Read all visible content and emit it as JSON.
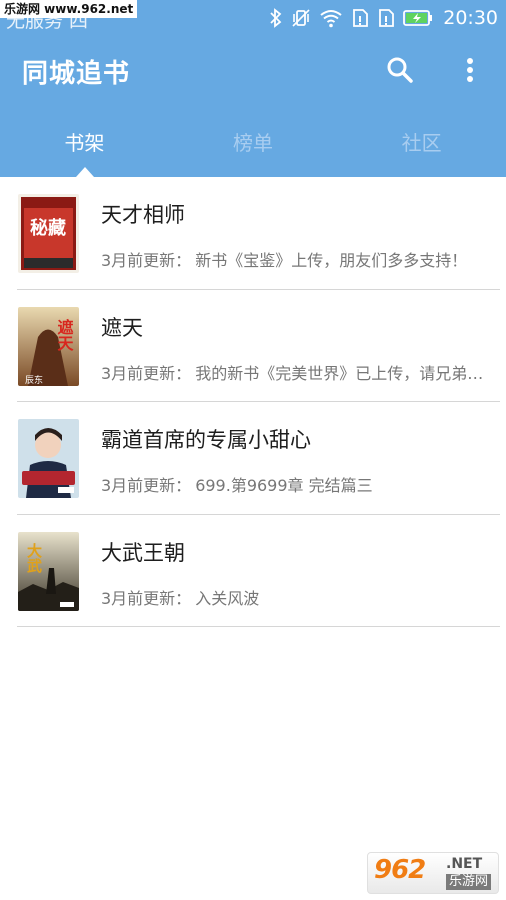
{
  "status_bar": {
    "carrier": "无服务 四",
    "time": "20:30",
    "watermark": "乐游网 www.962.net"
  },
  "toolbar": {
    "title": "同城追书",
    "icons": [
      "search-icon",
      "more-vert-icon"
    ]
  },
  "tabs": [
    {
      "label": "书架",
      "active": true
    },
    {
      "label": "榜单",
      "active": false
    },
    {
      "label": "社区",
      "active": false
    }
  ],
  "books": [
    {
      "title": "天才相师",
      "update_prefix": "3月前更新：",
      "latest": "新书《宝鉴》上传，朋友们多多支持！",
      "cover_text": "秘藏"
    },
    {
      "title": "遮天",
      "update_prefix": "3月前更新：",
      "latest": "我的新书《完美世界》已上传，请兄弟们支持",
      "cover_text": "遮天",
      "cover_author": "辰东"
    },
    {
      "title": "霸道首席的专属小甜心",
      "update_prefix": "3月前更新：",
      "latest": "699.第9699章 完结篇三"
    },
    {
      "title": "大武王朝",
      "update_prefix": "3月前更新：",
      "latest": "入关风波",
      "cover_text": "大武"
    }
  ],
  "watermark_bottom": {
    "logo": "962",
    "domain": ".NET",
    "name": "乐游网"
  },
  "colors": {
    "app_bar": "#66a9e2",
    "tab_inactive": "#a8cdf0",
    "text_primary": "#1e1e1e",
    "text_secondary": "#777777",
    "divider": "#d6d6d6"
  }
}
